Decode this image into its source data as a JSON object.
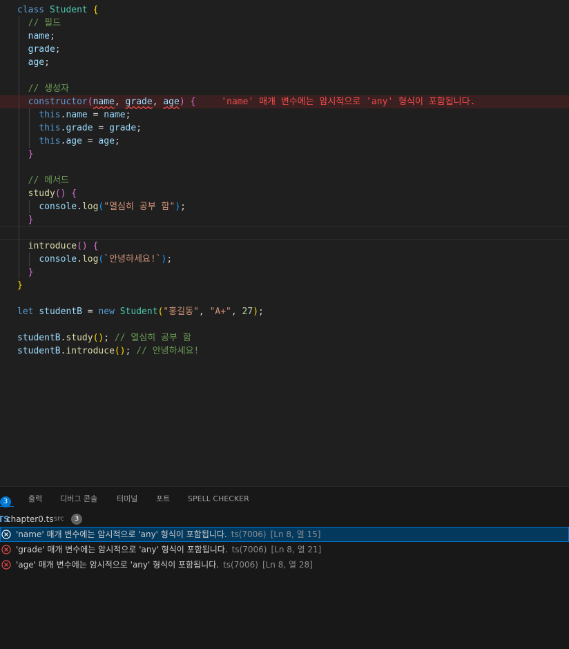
{
  "editor": {
    "comment_fields": "// 필드",
    "field_name": "name",
    "field_grade": "grade",
    "field_age": "age",
    "comment_ctor": "// 생성자",
    "inline_error": "'name' 매개 변수에는 암시적으로 'any' 형식이 포함됩니다.",
    "comment_methods": "// 메서드",
    "study_string": "\"열심히 공부 함\"",
    "introduce_string": "`안녕하세요!`",
    "student_name": "\"홍길동\"",
    "student_grade": "\"A+\"",
    "student_age": "27",
    "comment_study": "// 열심히 공부 함",
    "comment_introduce": "// 안녕하세요!"
  },
  "panel": {
    "problems_count": "3",
    "tabs": [
      "출력",
      "디버그 콘솔",
      "터미널",
      "포트",
      "SPELL CHECKER"
    ],
    "file": {
      "name": "chapter0.ts",
      "folder": "src",
      "count": "3"
    },
    "problems": [
      {
        "message": "'name' 매개 변수에는 암시적으로 'any' 형식이 포함됩니다.",
        "code": "ts(7006)",
        "position": "[Ln 8, 열 15]"
      },
      {
        "message": "'grade' 매개 변수에는 암시적으로 'any' 형식이 포함됩니다.",
        "code": "ts(7006)",
        "position": "[Ln 8, 열 21]"
      },
      {
        "message": "'age' 매개 변수에는 암시적으로 'any' 형식이 포함됩니다.",
        "code": "ts(7006)",
        "position": "[Ln 8, 열 28]"
      }
    ]
  }
}
